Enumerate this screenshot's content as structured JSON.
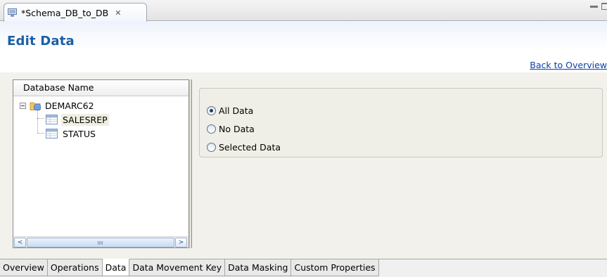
{
  "editor_tab": {
    "title": "*Schema_DB_to_DB",
    "close_glyph": "✕"
  },
  "header": {
    "title": "Edit Data",
    "back_link": "Back to Overview"
  },
  "tree": {
    "column_header": "Database Name",
    "root": {
      "label": "DEMARC62",
      "icon": "database-icon",
      "expanded": true
    },
    "children": [
      {
        "label": "SALESREP",
        "icon": "table-icon",
        "selected": true
      },
      {
        "label": "STATUS",
        "icon": "table-icon",
        "selected": false
      }
    ],
    "scroll_left_glyph": "<",
    "scroll_right_glyph": ">"
  },
  "data_options": {
    "items": [
      {
        "label": "All Data",
        "checked": true
      },
      {
        "label": "No Data",
        "checked": false
      },
      {
        "label": "Selected Data",
        "checked": false
      }
    ]
  },
  "page_tabs": [
    {
      "label": "Overview",
      "active": false
    },
    {
      "label": "Operations",
      "active": false
    },
    {
      "label": "Data",
      "active": true
    },
    {
      "label": "Data Movement Key",
      "active": false
    },
    {
      "label": "Data Masking",
      "active": false
    },
    {
      "label": "Custom Properties",
      "active": false
    }
  ],
  "colors": {
    "title": "#1b5ea7",
    "link": "#0b3fa8",
    "panel_bg": "#f2f1eb"
  }
}
